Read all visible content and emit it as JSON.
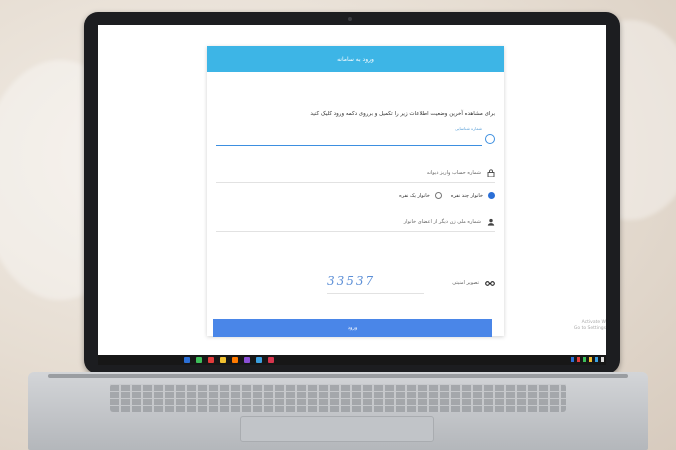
{
  "login": {
    "header": "ورود به سامانه",
    "intro": "برای مشاهده آخرین وضعیت اطلاعات زیر را تکمیل و برروی دکمه ورود کلیک کنید",
    "field1_label": "شماره شناسایی",
    "row_bank": "شماره حساب واریز دیوانه",
    "radio_multi": "خانوار چند نفره",
    "radio_single": "خانوار یک نفره",
    "row_id": "شماره ملی زن دیگر از اعضای خانوار",
    "captcha_label": "تصویر امنیتی",
    "captcha_value": "33537",
    "submit": "ورود"
  },
  "watermark": {
    "line1": "Activate W",
    "line2": "Go to Settings"
  },
  "taskbar": {
    "colors": [
      "#2b6fd6",
      "#3dbf5a",
      "#e23b3b",
      "#f0c030",
      "#ff7a00",
      "#8a4fd6",
      "#3aa0e0",
      "#d6354e"
    ]
  }
}
